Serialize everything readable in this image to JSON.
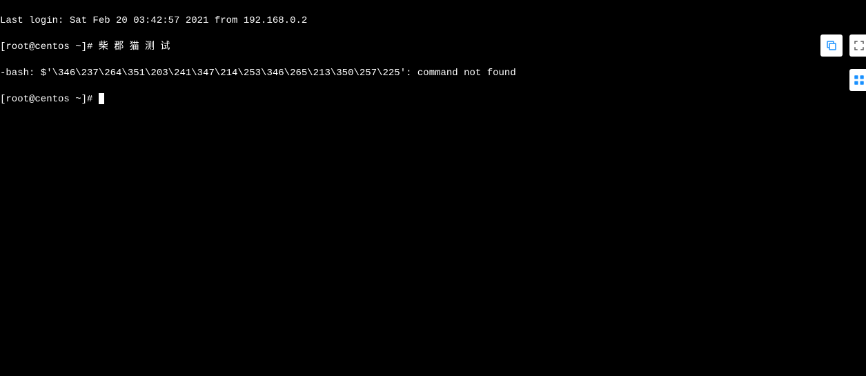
{
  "terminal": {
    "lines": [
      "Last login: Sat Feb 20 03:42:57 2021 from 192.168.0.2",
      "[root@centos ~]# 柴 郡 猫 测 试",
      "-bash: $'\\346\\237\\264\\351\\203\\241\\347\\214\\253\\346\\265\\213\\350\\257\\225': command not found",
      "[root@centos ~]# "
    ]
  },
  "colors": {
    "icon_blue": "#1890ff",
    "icon_gray": "#595959"
  }
}
